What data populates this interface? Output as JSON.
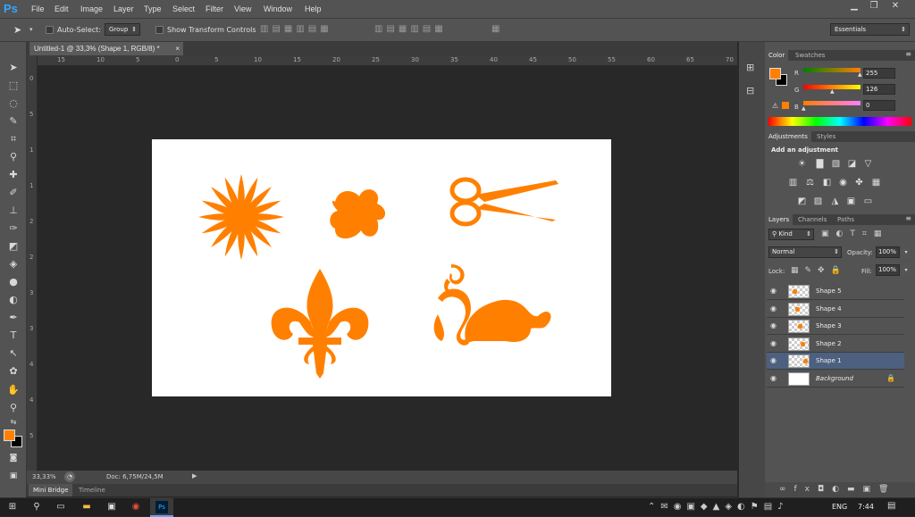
{
  "app": {
    "logo": "Ps"
  },
  "menubar": {
    "items": [
      "File",
      "Edit",
      "Image",
      "Layer",
      "Type",
      "Select",
      "Filter",
      "View",
      "Window",
      "Help"
    ]
  },
  "window_controls": {
    "minimize": "▁",
    "restore": "❐",
    "close": "✕"
  },
  "options_bar": {
    "auto_select_label": "Auto-Select:",
    "auto_select_value": "Group",
    "show_transform_label": "Show Transform Controls",
    "workspace": "Essentials"
  },
  "document": {
    "tab_title": "Untitled-1 @ 33,3% (Shape 1, RGB/8) *",
    "close": "×",
    "ruler_h": [
      "15",
      "10",
      "5",
      "0",
      "5",
      "10",
      "15",
      "20",
      "25",
      "30",
      "35",
      "40",
      "45",
      "50",
      "55",
      "60",
      "65",
      "70"
    ],
    "ruler_v": [
      "0",
      "5",
      "1",
      "1",
      "2",
      "2",
      "3",
      "3",
      "4",
      "4",
      "5"
    ],
    "zoom": "33,33%",
    "doc_info": "Doc: 6,75M/24,5M",
    "shapes_color": "#ff8000"
  },
  "bottom_tabs": {
    "mini_bridge": "Mini Bridge",
    "timeline": "Timeline"
  },
  "colors": {
    "foreground": "#ff8000",
    "background": "#000000"
  },
  "color_panel": {
    "tabs": [
      "Color",
      "Swatches"
    ],
    "r_label": "R",
    "g_label": "G",
    "b_label": "B",
    "r_value": "255",
    "g_value": "126",
    "b_value": "0"
  },
  "adjustments_panel": {
    "tabs": [
      "Adjustments",
      "Styles"
    ],
    "heading": "Add an adjustment"
  },
  "layers_panel": {
    "tabs": [
      "Layers",
      "Channels",
      "Paths"
    ],
    "kind_label": "Kind",
    "blend_mode": "Normal",
    "opacity_label": "Opacity:",
    "opacity_value": "100%",
    "lock_label": "Lock:",
    "fill_label": "Fill:",
    "fill_value": "100%",
    "layers": [
      {
        "name": "Shape 5",
        "selected": false
      },
      {
        "name": "Shape 4",
        "selected": false
      },
      {
        "name": "Shape 3",
        "selected": false
      },
      {
        "name": "Shape 2",
        "selected": false
      },
      {
        "name": "Shape 1",
        "selected": true
      },
      {
        "name": "Background",
        "selected": false
      }
    ]
  },
  "taskbar": {
    "language": "ENG",
    "time": "7:44"
  }
}
